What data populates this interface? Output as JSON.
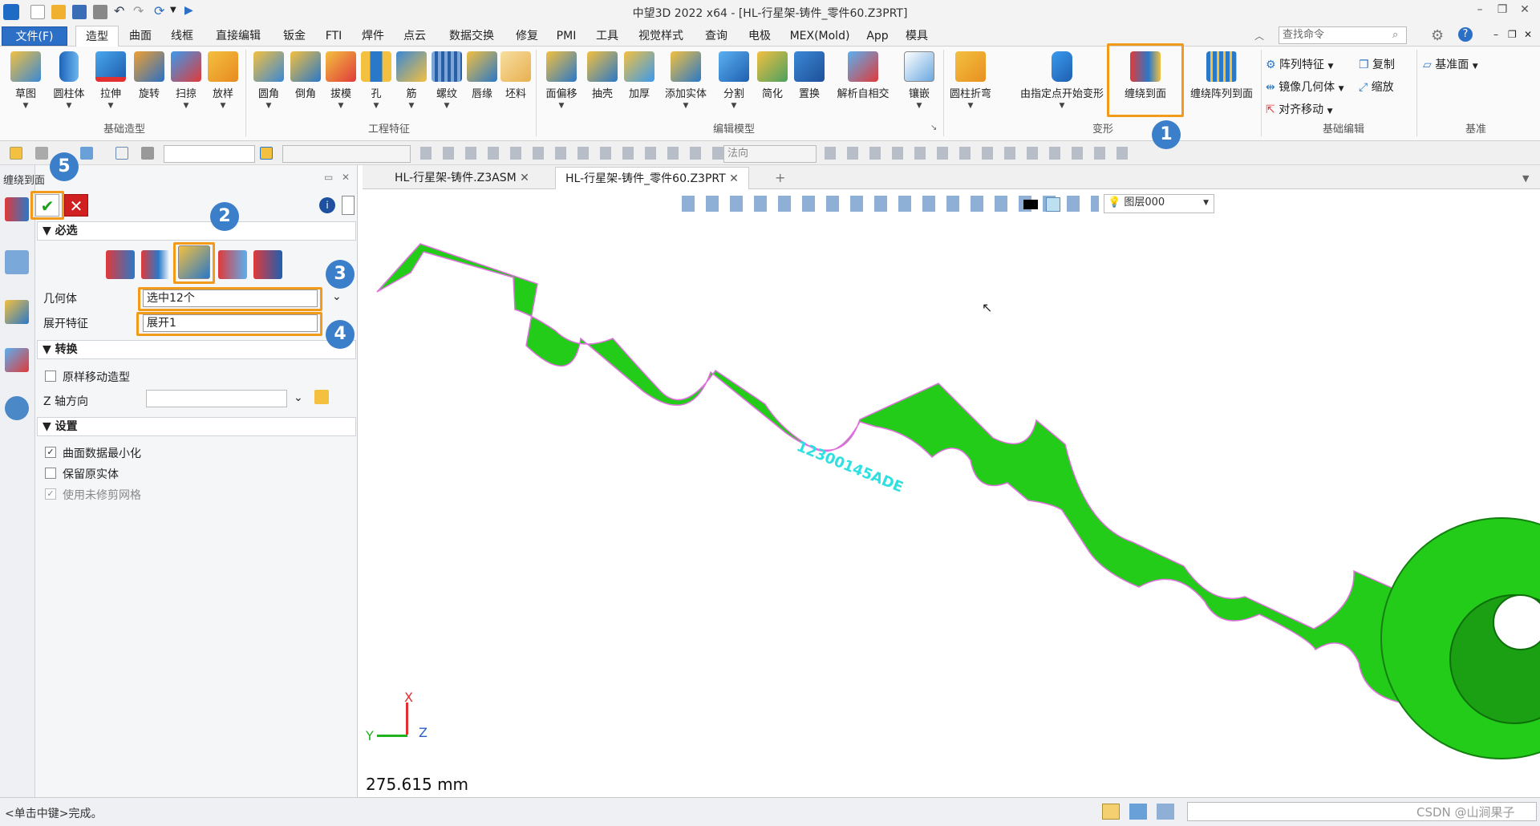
{
  "app": {
    "title": "中望3D 2022 x64 - [HL-行星架-铸件_零件60.Z3PRT]",
    "window_controls": [
      "minimize-icon",
      "restore-icon",
      "close-icon"
    ]
  },
  "menu": {
    "file": "文件(F)",
    "items": [
      "造型",
      "曲面",
      "线框",
      "直接编辑",
      "钣金",
      "FTI",
      "焊件",
      "点云",
      "数据交换",
      "修复",
      "PMI",
      "工具",
      "视觉样式",
      "查询",
      "电极",
      "MEX(Mold)",
      "App",
      "模具"
    ],
    "active": "造型",
    "search_placeholder": "查找命令"
  },
  "ribbon": {
    "groups": {
      "basic": {
        "label": "基础造型",
        "buttons": [
          "草图",
          "圆柱体",
          "拉伸",
          "旋转",
          "扫掠",
          "放样"
        ]
      },
      "eng": {
        "label": "工程特征",
        "buttons": [
          "圆角",
          "倒角",
          "拔模",
          "孔",
          "筋",
          "螺纹",
          "唇缘",
          "坯料"
        ]
      },
      "edit": {
        "label": "编辑模型",
        "buttons": [
          "面偏移",
          "抽壳",
          "加厚",
          "添加实体",
          "分割",
          "简化",
          "置换",
          "解析自相交",
          "镶嵌"
        ]
      },
      "deform": {
        "label": "变形",
        "buttons": [
          "圆柱折弯",
          "由指定点开始变形",
          "缠绕到面",
          "缠绕阵列到面"
        ]
      },
      "basic_edit": {
        "label": "基础编辑",
        "items": [
          "阵列特征",
          "复制",
          "镜像几何体",
          "缩放",
          "对齐移动"
        ]
      },
      "datum": {
        "label": "基准",
        "items": [
          "基准面"
        ]
      }
    }
  },
  "toolbar2": {
    "direction_combo": "法向"
  },
  "tabs": {
    "asm": "HL-行星架-铸件.Z3ASM",
    "prt": "HL-行星架-铸件_零件60.Z3PRT"
  },
  "panel": {
    "title": "缠绕到面",
    "sections": {
      "required": "必选",
      "transform": "转换",
      "settings": "设置"
    },
    "geometry_label": "几何体",
    "geometry_value": "选中12个",
    "unfold_label": "展开特征",
    "unfold_value": "展开1",
    "move_label": "原样移动造型",
    "zaxis_label": "Z 轴方向",
    "zaxis_value": "",
    "opt_minimize": "曲面数据最小化",
    "opt_keep": "保留原实体",
    "opt_untrimmed": "使用未修剪网格",
    "minimize_checked": true,
    "keep_checked": false,
    "untrimmed_checked": true
  },
  "viewport": {
    "layer": "图层000",
    "engraved_text": "12300145ADE",
    "scale_text": "275.615 mm",
    "axis_x": "X",
    "axis_y": "Y",
    "axis_z": "Z"
  },
  "status": {
    "hint": "<单击中键>完成。",
    "watermark": "CSDN @山涧果子"
  },
  "badges": [
    "1",
    "2",
    "3",
    "4",
    "5"
  ],
  "colors": {
    "accent_blue": "#2b6fc6",
    "highlight_orange": "#f29b1b",
    "badge_blue": "#3b7ec9",
    "model_green": "#22cc18",
    "edge_pink": "#e070e0",
    "text_cyan": "#30e0e0"
  }
}
